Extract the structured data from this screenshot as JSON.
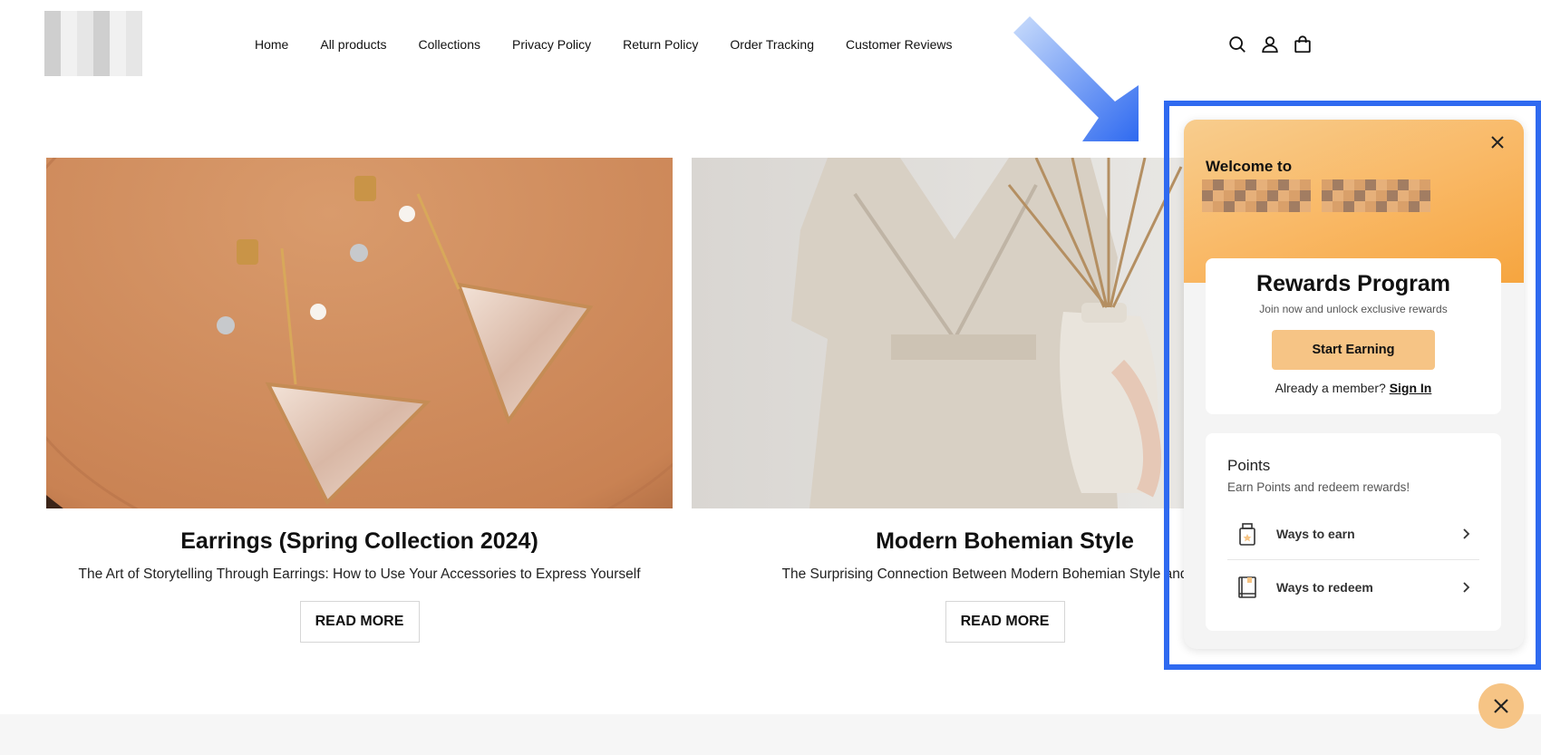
{
  "header": {
    "nav": [
      "Home",
      "All products",
      "Collections",
      "Privacy Policy",
      "Return Policy",
      "Order Tracking",
      "Customer Reviews"
    ],
    "icons": [
      "search-icon",
      "account-icon",
      "cart-icon"
    ]
  },
  "cards": [
    {
      "title": "Earrings (Spring Collection 2024)",
      "description": "The Art of Storytelling Through Earrings: How to Use Your Accessories to Express Yourself",
      "button": "READ MORE"
    },
    {
      "title": "Modern Bohemian Style",
      "description": "The Surprising Connection Between Modern Bohemian Style and Susta",
      "button": "READ MORE"
    }
  ],
  "widget": {
    "welcome": "Welcome to",
    "rewards_title": "Rewards Program",
    "rewards_subtitle": "Join now and unlock exclusive rewards",
    "start_button": "Start Earning",
    "member_text": "Already a member?",
    "sign_in": "Sign In",
    "points_title": "Points",
    "points_subtitle": "Earn Points and redeem rewards!",
    "ways_to_earn": "Ways to earn",
    "ways_to_redeem": "Ways to redeem"
  },
  "colors": {
    "accent": "#f6c485",
    "header_gradient_end": "#f6a53f",
    "highlight": "#2f6af0"
  }
}
